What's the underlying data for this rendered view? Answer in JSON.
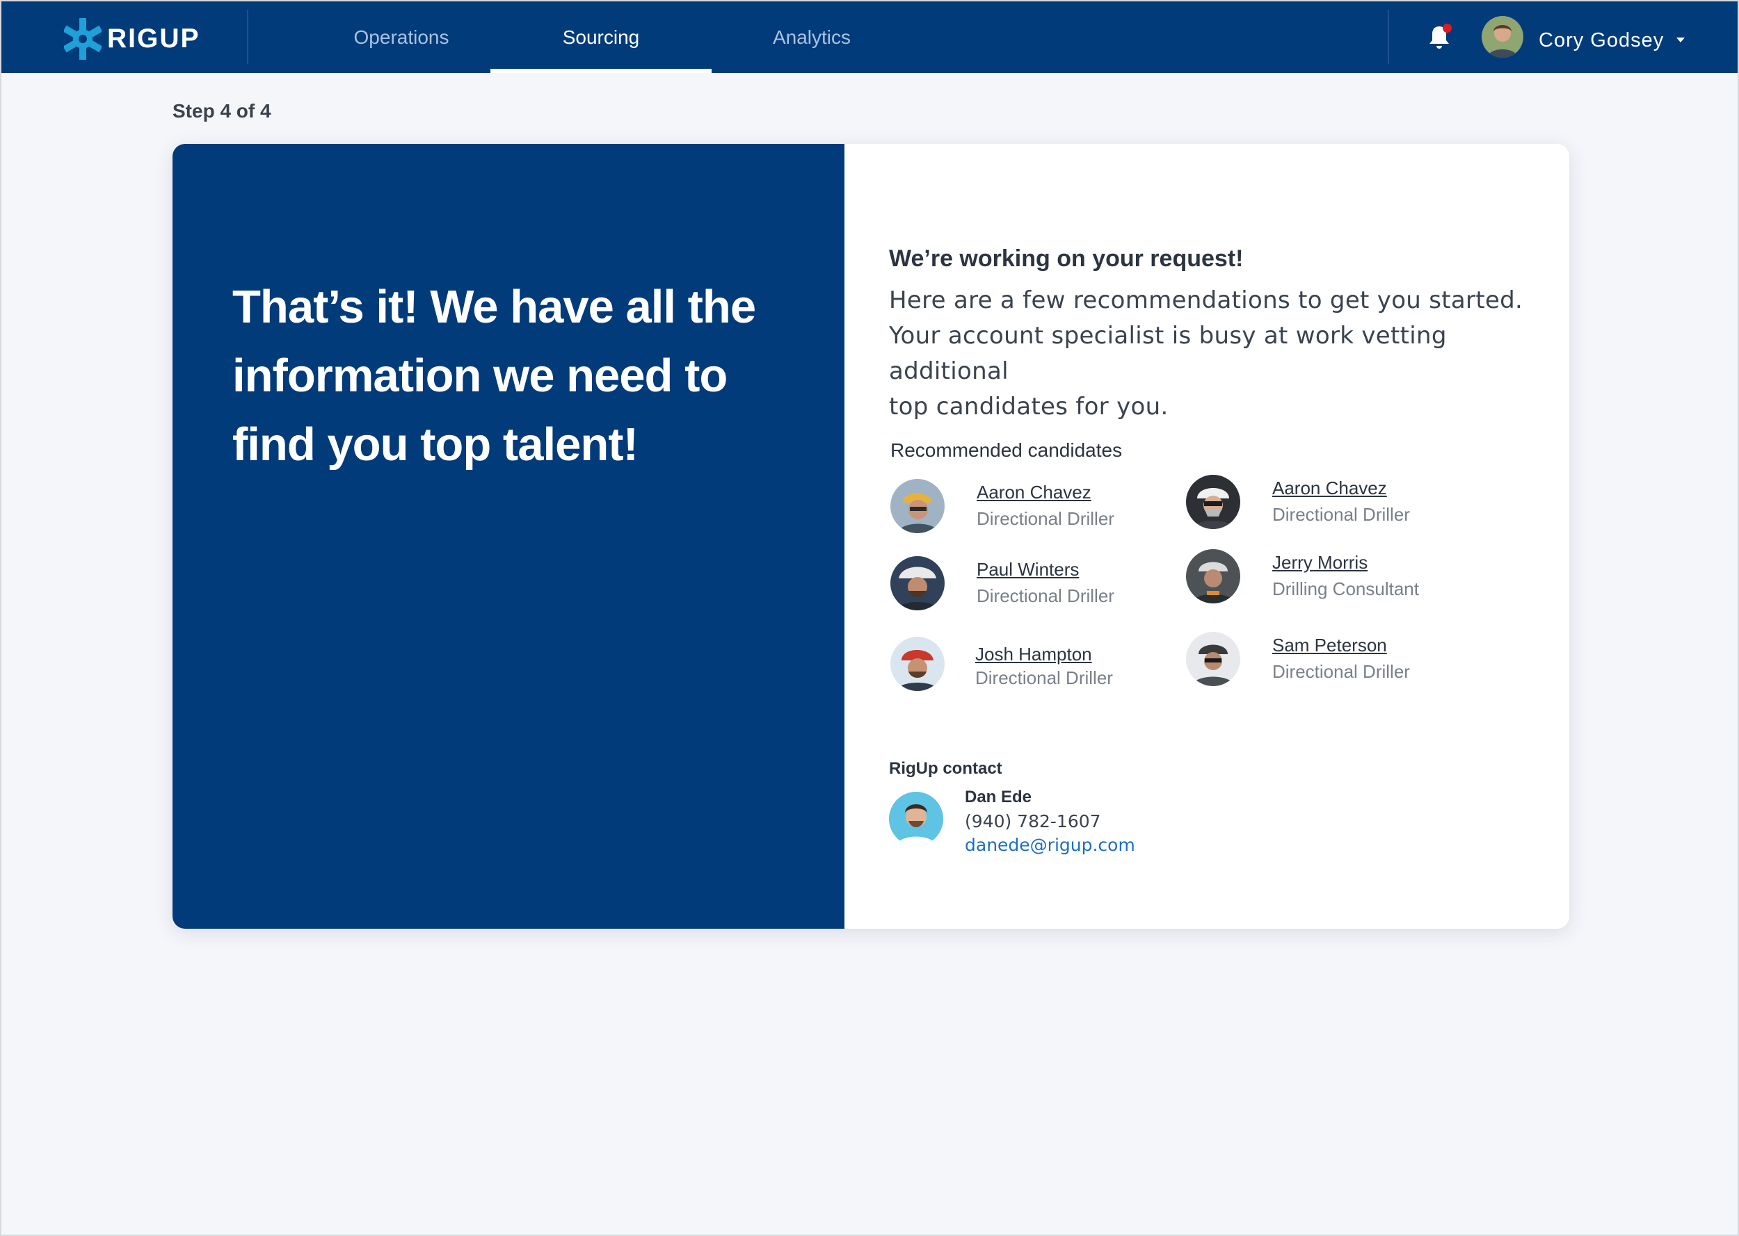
{
  "brand": {
    "name": "RIGUP",
    "accent": "#013b7a",
    "logo_color": "#1fa0d6"
  },
  "nav": {
    "tabs": [
      {
        "label": "Operations",
        "active": false
      },
      {
        "label": "Sourcing",
        "active": true
      },
      {
        "label": "Analytics",
        "active": false
      }
    ]
  },
  "header": {
    "notifications_icon": "bell-icon",
    "has_unread": true,
    "user_name": "Cory Godsey",
    "user_menu_icon": "caret-down-icon"
  },
  "step": "Step 4 of 4",
  "hero": {
    "line1": "That’s it! We have all the",
    "line2": "information we need to",
    "line3": "find you top talent!"
  },
  "request": {
    "title": "We’re working on your request!",
    "line1": "Here are a few recommendations to get you started.",
    "line2": "Your account specialist is busy at work vetting additional",
    "line3": "top candidates for you."
  },
  "recommended": {
    "title": "Recommended candidates",
    "candidates": [
      {
        "name": "Aaron Chavez",
        "role": "Directional Driller"
      },
      {
        "name": "Aaron Chavez",
        "role": "Directional Driller"
      },
      {
        "name": "Paul Winters",
        "role": "Directional Driller"
      },
      {
        "name": "Jerry Morris",
        "role": "Drilling Consultant"
      },
      {
        "name": "Josh Hampton",
        "role": "Directional Driller"
      },
      {
        "name": "Sam Peterson",
        "role": "Directional Driller"
      }
    ]
  },
  "contact": {
    "title": "RigUp contact",
    "name": "Dan Ede",
    "phone": "(940) 782-1607",
    "email": "danede@rigup.com"
  }
}
